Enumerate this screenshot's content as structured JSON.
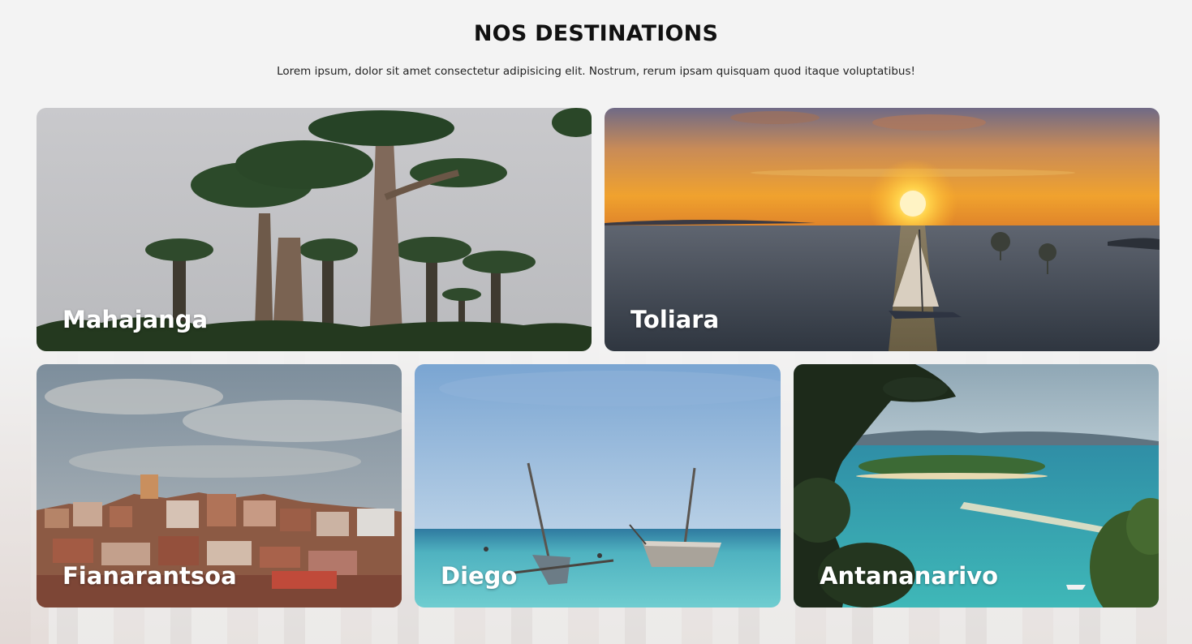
{
  "section": {
    "title": "NOS DESTINATIONS",
    "subtitle": "Lorem ipsum, dolor sit amet consectetur adipisicing elit. Nostrum, rerum ipsam quisquam quod itaque voluptatibus!"
  },
  "destinations": [
    {
      "name": "Mahajanga",
      "image": "baobab-trees-photo"
    },
    {
      "name": "Toliara",
      "image": "sunset-sailboat-photo"
    },
    {
      "name": "Fianarantsoa",
      "image": "hillside-town-photo"
    },
    {
      "name": "Diego",
      "image": "boats-turquoise-sea-photo"
    },
    {
      "name": "Antananarivo",
      "image": "island-lagoon-photo"
    }
  ],
  "colors": {
    "page_background": "#f3f3f3",
    "title_text": "#111111",
    "card_label_text": "#ffffff"
  }
}
